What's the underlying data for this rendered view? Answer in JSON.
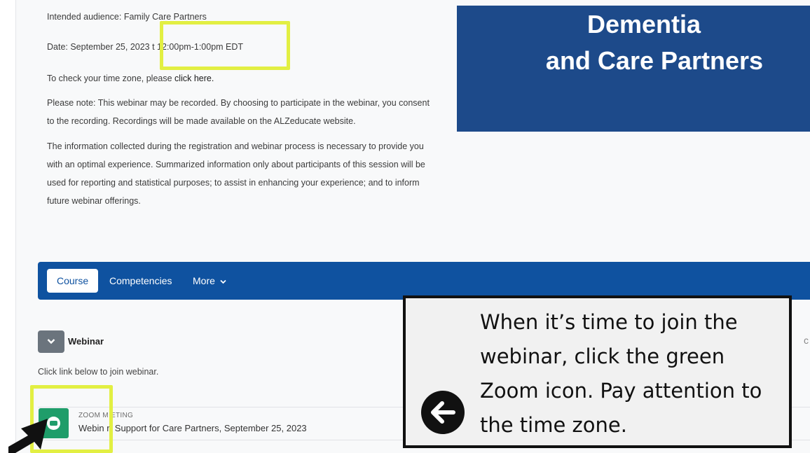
{
  "info": {
    "audience": "Intended audience: Family Care Partners",
    "date_prefix": "Date: September 25, 2023",
    "date_time": "t 12:00pm-1:00pm EDT",
    "timezone_prefix": "To check your time zone, please ",
    "timezone_link": "click here.",
    "note_paragraph": "Please note: This webinar may be recorded. By choosing to participate in the webinar, you consent to the recording. Recordings will be made available on the ALZeducate website.",
    "privacy_paragraph": " The information collected during the registration and webinar process is necessary to provide you with an optimal experience. Summarized information only about participants of this session will be used for reporting and statistical purposes; to assist in enhancing your experience; and to inform future webinar offerings."
  },
  "banner": {
    "line1": "Dementia",
    "line2": "and Care Partners",
    "color": "#1d4a8a"
  },
  "nav": {
    "course": "Course",
    "competencies": "Competencies",
    "more": "More",
    "more_icon": "chevron-down-icon",
    "color": "#0f52a0"
  },
  "section": {
    "toggle_icon": "chevron-down-icon",
    "title": "Webinar",
    "description": "Click link below to join webinar."
  },
  "activity": {
    "icon": "zoom-icon",
    "icon_color": "#1f9d6a",
    "type": "ZOOM M   ETING",
    "name": "Webin   r: Support for Care Partners, September 25, 2023"
  },
  "callout": {
    "text": "When it’s time to join the webinar, click the green Zoom icon. Pay attention to the time zone.",
    "icon": "left-arrow-icon"
  },
  "edge_char": "c",
  "highlight_color": "#e2ef42"
}
